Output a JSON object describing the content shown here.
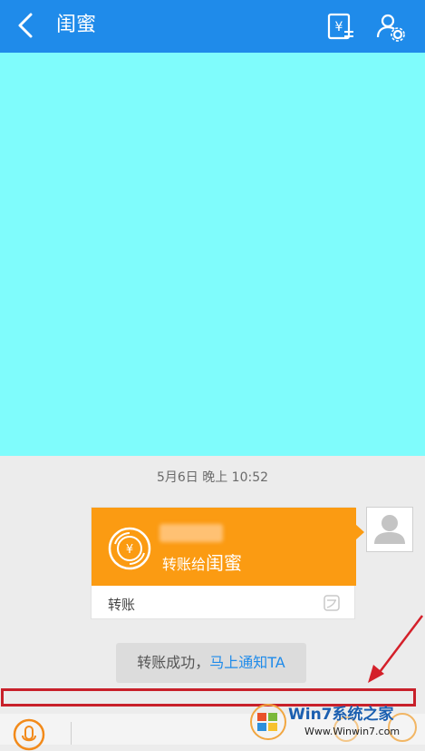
{
  "header": {
    "title": "闺蜜",
    "back_icon": "chevron-left-icon",
    "transfer_icon": "yuan-transfer-icon",
    "settings_icon": "user-settings-icon",
    "color": "#1f8bea"
  },
  "chat": {
    "timestamp": "5月6日 晚上 10:52",
    "transfer_card": {
      "message_prefix": "转账给",
      "recipient": "闺蜜",
      "footer_label": "转账",
      "card_color": "#fb9b12"
    },
    "notice": {
      "text": "转账成功，",
      "link": "马上通知TA"
    }
  },
  "watermark": {
    "brand": "Win7系统之家",
    "url": "Www.Winwin7.com"
  }
}
